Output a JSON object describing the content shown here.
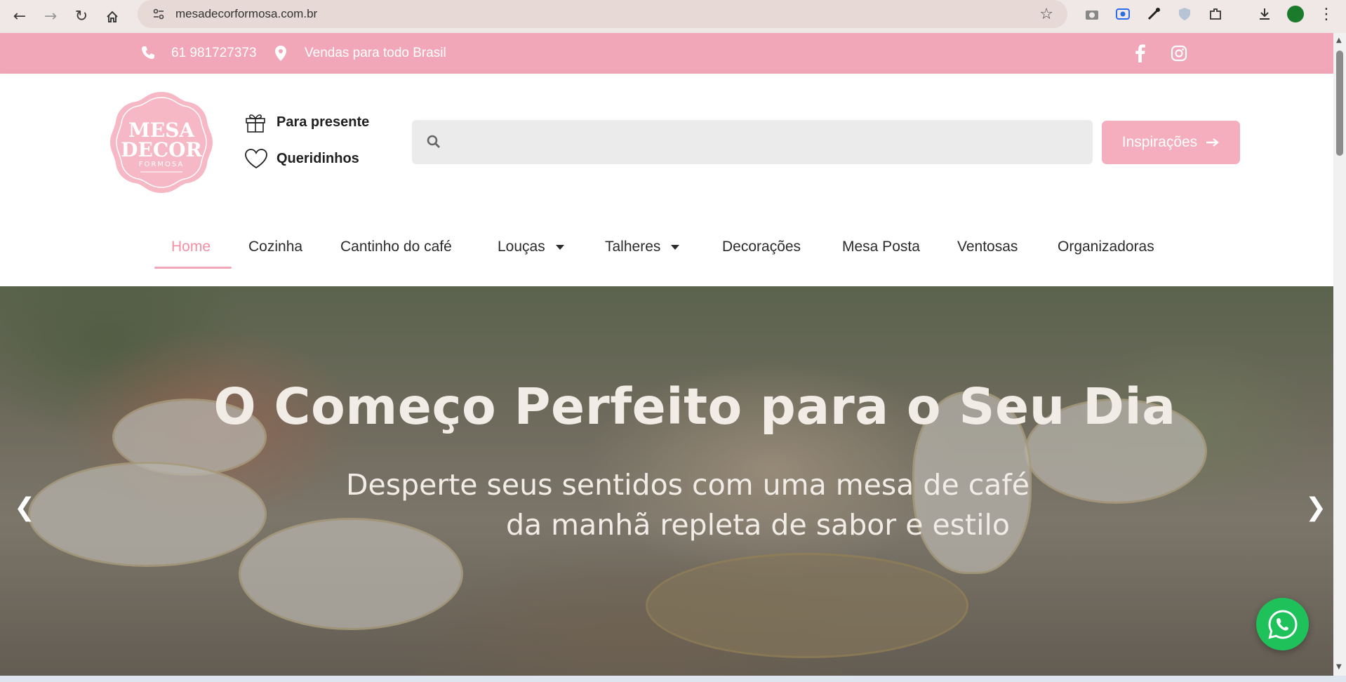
{
  "browser": {
    "url": "mesadecorformosa.com.br"
  },
  "topbar": {
    "phone": "61 981727373",
    "shipping": "Vendas para todo Brasil"
  },
  "header": {
    "logo": {
      "line1": "MESA",
      "line2": "DECOR",
      "line3": "FORMOSA"
    },
    "gift_label": "Para presente",
    "fav_label": "Queridinhos",
    "search_placeholder": "",
    "inspiration_label": "Inspirações"
  },
  "nav": {
    "items": [
      {
        "label": "Home"
      },
      {
        "label": "Cozinha"
      },
      {
        "label": "Cantinho do café"
      },
      {
        "label": "Louças"
      },
      {
        "label": "Talheres"
      },
      {
        "label": "Decorações"
      },
      {
        "label": "Mesa Posta"
      },
      {
        "label": "Ventosas"
      },
      {
        "label": "Organizadoras"
      }
    ]
  },
  "hero": {
    "title": "O Começo Perfeito para o Seu Dia",
    "subtitle_line1": "Desperte seus sentidos com uma mesa de café",
    "subtitle_line2": "da manhã repleta de sabor e estilo"
  },
  "colors": {
    "brand_pink": "#f2a7b8",
    "active_pink": "#f38fa5",
    "whatsapp_green": "#1fc15a"
  }
}
